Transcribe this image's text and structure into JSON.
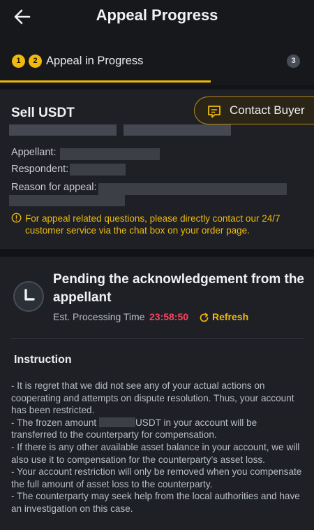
{
  "header": {
    "title": "Appeal Progress"
  },
  "steps": {
    "dot1": "1",
    "dot2": "2",
    "dot3": "3",
    "current_label": "Appeal in Progress"
  },
  "order": {
    "title": "Sell USDT",
    "contact_label": "Contact Buyer",
    "appellant_label": "Appellant:",
    "respondent_label": "Respondent:",
    "reason_label": "Reason for appeal:",
    "notice": "For appeal related questions, please directly contact our 24/7 customer service via the chat box on your order page."
  },
  "status": {
    "title": "Pending the acknowledgement from the appellant",
    "est_label": "Est. Processing Time",
    "timer": "23:58:50",
    "refresh_label": "Refresh"
  },
  "instruction": {
    "title": "Instruction",
    "p1": "- It is regret that we did not see any of your actual actions on cooperating and attempts on dispute resolution. Thus, your account has been restricted.",
    "p2a": "- The frozen amount",
    "p2b": "USDT in your account will be transferred to the counterparty for compensation.",
    "p3": "- If there is any other available asset balance in your account, we will also use it to compensation for the counterparty’s asset loss.",
    "p4": "- Your account restriction will only be removed when you compensate the full amount of asset loss to the counterparty.",
    "p5": "- The counterparty may seek help from the local authorities and have an investigation on this case."
  },
  "colors": {
    "accent": "#f0b90b",
    "timer": "#f6465d",
    "background": "#121316",
    "card": "#1e2026"
  },
  "icons": [
    "back-arrow-icon",
    "chat-icon",
    "info-icon",
    "clock-icon",
    "refresh-icon"
  ]
}
